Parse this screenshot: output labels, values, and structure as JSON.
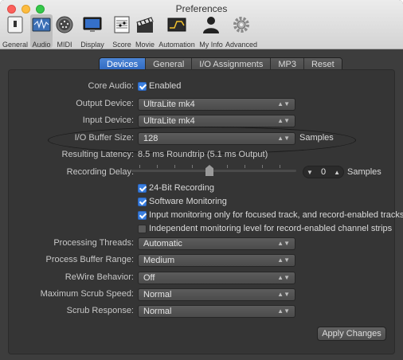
{
  "window": {
    "title": "Preferences"
  },
  "toolbar": {
    "items": [
      {
        "label": "General",
        "icon": "general-icon"
      },
      {
        "label": "Audio",
        "icon": "audio-icon"
      },
      {
        "label": "MIDI",
        "icon": "midi-icon"
      },
      {
        "label": "Display",
        "icon": "display-icon"
      },
      {
        "label": "Score",
        "icon": "score-icon"
      },
      {
        "label": "Movie",
        "icon": "movie-icon"
      },
      {
        "label": "Automation",
        "icon": "automation-icon"
      },
      {
        "label": "My Info",
        "icon": "my-info-icon"
      },
      {
        "label": "Advanced",
        "icon": "advanced-icon"
      }
    ]
  },
  "tabs": [
    "Devices",
    "General",
    "I/O Assignments",
    "MP3",
    "Reset"
  ],
  "form": {
    "core_audio_label": "Core Audio:",
    "core_audio_value": "Enabled",
    "output_device_label": "Output Device:",
    "output_device_value": "UltraLite mk4",
    "input_device_label": "Input Device:",
    "input_device_value": "UltraLite mk4",
    "buffer_size_label": "I/O Buffer Size:",
    "buffer_size_value": "128",
    "buffer_size_unit": "Samples",
    "latency_label": "Resulting Latency:",
    "latency_value": "8.5 ms Roundtrip (5.1 ms Output)",
    "recording_delay_label": "Recording Delay:",
    "recording_delay_value": "0",
    "recording_delay_unit": "Samples",
    "checks": [
      {
        "label": "24-Bit Recording",
        "checked": true
      },
      {
        "label": "Software Monitoring",
        "checked": true
      },
      {
        "label": "Input monitoring only for focused track, and record-enabled tracks",
        "checked": true
      },
      {
        "label": "Independent monitoring level for record-enabled channel strips",
        "checked": false
      }
    ],
    "processing_threads_label": "Processing Threads:",
    "processing_threads_value": "Automatic",
    "process_buffer_label": "Process Buffer Range:",
    "process_buffer_value": "Medium",
    "rewire_label": "ReWire Behavior:",
    "rewire_value": "Off",
    "max_scrub_label": "Maximum Scrub Speed:",
    "max_scrub_value": "Normal",
    "scrub_response_label": "Scrub Response:",
    "scrub_response_value": "Normal",
    "apply_label": "Apply Changes"
  },
  "colors": {
    "accent": "#3a7fe0",
    "panel": "#353535"
  }
}
